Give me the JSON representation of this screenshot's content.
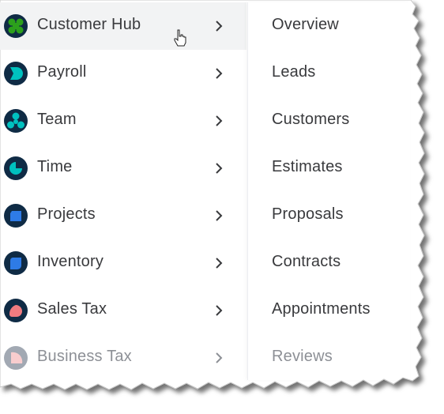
{
  "left_menu": {
    "items": [
      {
        "label": "Customer Hub",
        "icon": "customer-hub-icon",
        "icon_color": "#2ca01c",
        "active": true
      },
      {
        "label": "Payroll",
        "icon": "payroll-icon",
        "icon_color": "#00c1bf"
      },
      {
        "label": "Team",
        "icon": "team-icon",
        "icon_color": "#00c1bf"
      },
      {
        "label": "Time",
        "icon": "time-icon",
        "icon_color": "#00c1bf"
      },
      {
        "label": "Projects",
        "icon": "projects-icon",
        "icon_color": "#2e7be6"
      },
      {
        "label": "Inventory",
        "icon": "inventory-icon",
        "icon_color": "#2e7be6"
      },
      {
        "label": "Sales Tax",
        "icon": "sales-tax-icon",
        "icon_color": "#f07b80"
      },
      {
        "label": "Business Tax",
        "icon": "business-tax-icon",
        "icon_color": "#f07b80",
        "muted": true
      }
    ]
  },
  "submenu": {
    "items": [
      {
        "label": "Overview"
      },
      {
        "label": "Leads"
      },
      {
        "label": "Customers"
      },
      {
        "label": "Estimates"
      },
      {
        "label": "Proposals"
      },
      {
        "label": "Contracts"
      },
      {
        "label": "Appointments"
      },
      {
        "label": "Reviews",
        "muted": true
      }
    ]
  },
  "colors": {
    "text": "#393a3d",
    "muted_text": "#8d9096",
    "active_row": "#f2f3f4",
    "icon_bg": "#0f2b45"
  }
}
